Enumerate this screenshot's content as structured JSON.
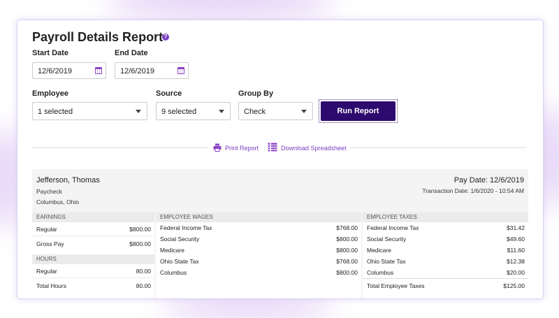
{
  "title": "Payroll Details Report",
  "help_icon": "question-icon",
  "start_date": {
    "label": "Start Date",
    "value": "12/6/2019"
  },
  "end_date": {
    "label": "End Date",
    "value": "12/6/2019"
  },
  "employee": {
    "label": "Employee",
    "value": "1 selected"
  },
  "source": {
    "label": "Source",
    "value": "9 selected"
  },
  "group_by": {
    "label": "Group By",
    "value": "Check"
  },
  "run_report_label": "Run Report",
  "actions": {
    "print": "Print Report",
    "download": "Download Spreadsheet"
  },
  "colors": {
    "accent": "#7b3fc0",
    "button": "#2d0a6e"
  },
  "report": {
    "employee_name": "Jefferson, Thomas",
    "type": "Paycheck",
    "location": "Columbus, Ohio",
    "pay_date": "Pay Date: 12/6/2019",
    "transaction_date": "Transaction Date: 1/6/2020 - 10:54 AM",
    "earnings": {
      "header": "EARNINGS",
      "rows": [
        {
          "label": "Regular",
          "value": "$800.00"
        },
        {
          "label": "Gross Pay",
          "value": "$800.00"
        }
      ]
    },
    "hours": {
      "header": "HOURS",
      "rows": [
        {
          "label": "Regular",
          "value": "80.00"
        },
        {
          "label": "Total Hours",
          "value": "80.00"
        }
      ]
    },
    "wages": {
      "header": "EMPLOYEE WAGES",
      "rows": [
        {
          "label": "Federal Income Tax",
          "value": "$768.00"
        },
        {
          "label": "Social Security",
          "value": "$800.00"
        },
        {
          "label": "Medicare",
          "value": "$800.00"
        },
        {
          "label": "Ohio State Tax",
          "value": "$768.00"
        },
        {
          "label": "Columbus",
          "value": "$800.00"
        }
      ]
    },
    "taxes": {
      "header": "EMPLOYEE TAXES",
      "rows": [
        {
          "label": "Federal Income Tax",
          "value": "$31.42"
        },
        {
          "label": "Social Security",
          "value": "$49.60"
        },
        {
          "label": "Medicare",
          "value": "$11.60"
        },
        {
          "label": "Ohio State Tax",
          "value": "$12.38"
        },
        {
          "label": "Columbus",
          "value": "$20.00"
        },
        {
          "label": "Total Employee Taxes",
          "value": "$125.00"
        }
      ]
    }
  }
}
